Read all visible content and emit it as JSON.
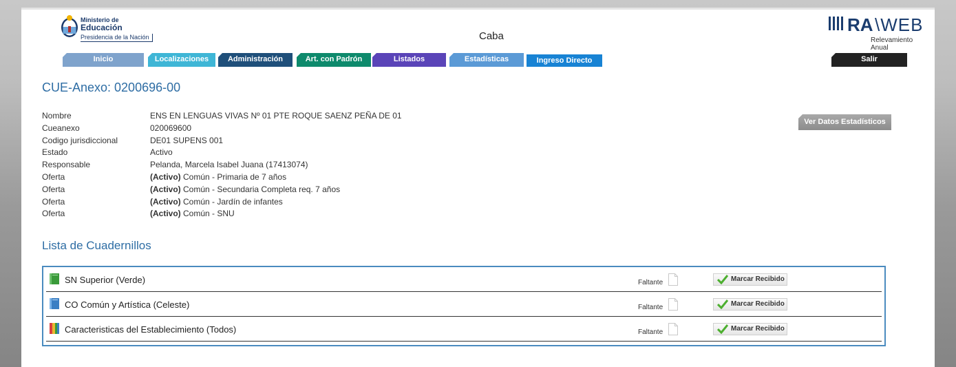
{
  "header": {
    "ministry_line1": "Ministerio de",
    "ministry_line2": "Educación",
    "ministry_line3": "Presidencia de la Nación",
    "jurisdiction": "Caba",
    "brand": {
      "ra": "RA",
      "web": "\\WEB",
      "subtitle": "Relevamiento Anual"
    }
  },
  "nav": {
    "tabs": [
      {
        "label": "Inicio",
        "color": "#7fa3cc"
      },
      {
        "label": "Localizaciones",
        "color": "#3fb6d6"
      },
      {
        "label": "Administración",
        "color": "#1f4f7a"
      },
      {
        "label": "Art. con Padrón",
        "color": "#0e8a6c"
      },
      {
        "label": "Listados",
        "color": "#5a44b8"
      },
      {
        "label": "Estadísticas",
        "color": "#5b9ad6"
      },
      {
        "label": "Ingreso Directo",
        "color": "#1883d4"
      }
    ],
    "logout": {
      "label": "Salir",
      "color": "#222222"
    }
  },
  "cue": {
    "title": "CUE-Anexo: 0200696-00",
    "fields": [
      {
        "label": "Nombre",
        "value": "ENS EN LENGUAS VIVAS Nº 01 PTE ROQUE SAENZ PEÑA DE 01"
      },
      {
        "label": "Cueanexo",
        "value": "020069600"
      },
      {
        "label": "Codigo jurisdiccional",
        "value": "DE01 SUPENS 001"
      },
      {
        "label": "Estado",
        "value": "Activo"
      },
      {
        "label": "Responsable",
        "value": "Pelanda, Marcela Isabel Juana (17413074)"
      }
    ],
    "ofertas": [
      {
        "label": "Oferta",
        "status": "(Activo)",
        "value": " Común - Primaria de 7 años"
      },
      {
        "label": "Oferta",
        "status": "(Activo)",
        "value": " Común - Secundaria Completa req. 7 años"
      },
      {
        "label": "Oferta",
        "status": "(Activo)",
        "value": " Común - Jardín de infantes"
      },
      {
        "label": "Oferta",
        "status": "(Activo)",
        "value": " Común - SNU"
      }
    ],
    "ver_datos_button": "Ver Datos Estadísticos"
  },
  "cuadernillos": {
    "title": "Lista de Cuadernillos",
    "items": [
      {
        "name": "SN Superior (Verde)",
        "icon": "green-book-icon",
        "status": "Faltante",
        "action": "Marcar Recibido"
      },
      {
        "name": "CO Común y Artística (Celeste)",
        "icon": "blue-book-icon",
        "status": "Faltante",
        "action": "Marcar Recibido"
      },
      {
        "name": "Caracteristicas del Establecimiento (Todos)",
        "icon": "multicolor-book-icon",
        "status": "Faltante",
        "action": "Marcar Recibido"
      }
    ]
  }
}
